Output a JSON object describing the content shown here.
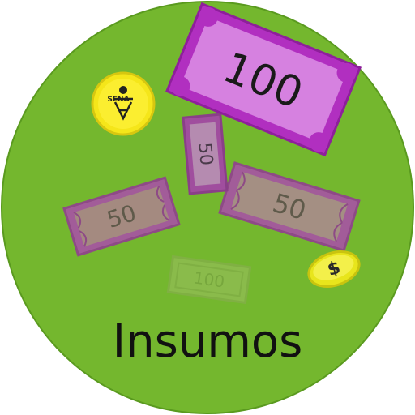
{
  "badge": {
    "title": "Insumos",
    "background_color": "#74b72e",
    "outline_color": "#5a9a1f"
  },
  "logo": {
    "text": "SENA",
    "coin_color": "#f5e61a"
  },
  "bills": [
    {
      "denomination": "100",
      "color": "#c35fcc"
    },
    {
      "denomination": "50",
      "color": "#a45ea8"
    },
    {
      "denomination": "50",
      "color": "#a47e8f"
    },
    {
      "denomination": "50",
      "color": "#a48a8f"
    },
    {
      "denomination": "100",
      "color": "#96ab6a"
    }
  ],
  "coin": {
    "symbol": "$",
    "color": "#e8e51c"
  }
}
